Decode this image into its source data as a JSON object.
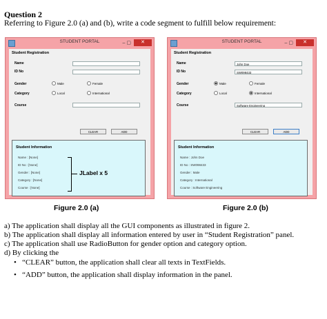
{
  "question": {
    "title": "Question 2",
    "intro": "Referring to Figure 2.0 (a) and (b), write a code segment to fulfill below requirement:"
  },
  "window": {
    "title": "STUDENT PORTAL",
    "controls": "–  ▢",
    "close_glyph": "✕"
  },
  "form": {
    "section_title": "Student Registration",
    "name_label": "Name",
    "id_label": "ID No",
    "gender_label": "Gender",
    "category_label": "Category",
    "course_label": "Course",
    "male_option": "Male",
    "female_option": "Female",
    "local_option": "Local",
    "international_option": "International",
    "clear_button": "CLEAR",
    "add_button": "ADD"
  },
  "figure_a": {
    "caption": "Figure 2.0 (a)",
    "info_title": "Student Information",
    "info_lines": [
      "Name : [None]",
      "ID No : [None]",
      "Gender : [None]",
      "Category : [None]",
      "Course : [None]"
    ],
    "annotation": "JLabel x 5"
  },
  "figure_b": {
    "caption": "Figure 2.0 (b)",
    "name_value": "John Doe",
    "id_value": "SW098433",
    "course_value": "Software Engineering",
    "selected_gender": "Male",
    "selected_category": "International",
    "info_title": "Student Information",
    "info_lines": [
      "Name : John Doe",
      "ID No : SW098433",
      "Gender : Male",
      "Category : International",
      "Course : Software Engineering"
    ]
  },
  "requirements": [
    "a)  The application shall display all the GUI components as illustrated in figure 2.",
    "b)  The application shall display all information entered by user in “Student Registration” panel.",
    "c)  The application shall use RadioButton for gender option and category option.",
    "d)  By clicking the"
  ],
  "bullets": [
    "“CLEAR” button, the application shall clear all texts in TextFields.",
    "“ADD” button, the application shall display information in the panel."
  ],
  "bullet_char": "•",
  "colors": {
    "window_frame": "#f5a3a7",
    "info_panel": "#d9f7fb",
    "close_button": "#c9302c"
  }
}
